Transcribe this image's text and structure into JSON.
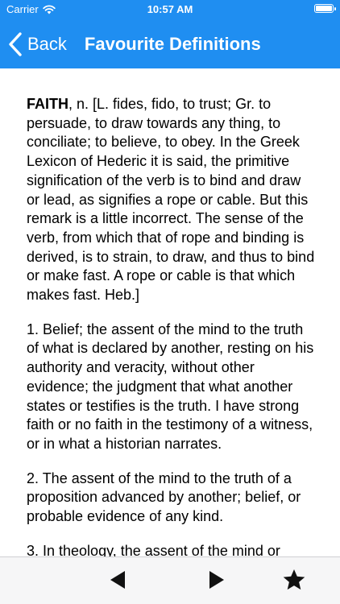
{
  "status_bar": {
    "carrier": "Carrier",
    "time": "10:57 AM"
  },
  "nav": {
    "back_label": "Back",
    "title": "Favourite Definitions"
  },
  "definition": {
    "term": "FAITH",
    "etymology": ", n. [L. fides, fido, to trust; Gr. to persuade, to draw towards any thing, to conciliate; to believe, to obey. In the Greek Lexicon of Hederic it is said, the primitive signification of the verb is to bind and draw or lead, as signifies a rope or cable. But this remark is a little incorrect. The sense of the verb, from which that of rope and binding is derived, is to strain, to draw, and thus to bind or make fast. A rope or cable is that which makes fast. Heb.]",
    "senses": [
      "1. Belief; the assent of the mind to the truth of what is declared by another, resting on his authority and veracity, without other evidence; the judgment that what another states or testifies is the truth. I have strong faith or no faith in the testimony of a witness, or in what a historian narrates.",
      "2. The assent of the mind to the truth of a proposition advanced by another; belief, or probable evidence of any kind.",
      "3. In theology, the assent of the mind or"
    ]
  },
  "toolbar": {
    "prev_icon": "previous-icon",
    "next_icon": "next-icon",
    "favourite_icon": "star-icon"
  },
  "colors": {
    "header": "#1f8ef1",
    "toolbar": "#f6f6f7"
  }
}
